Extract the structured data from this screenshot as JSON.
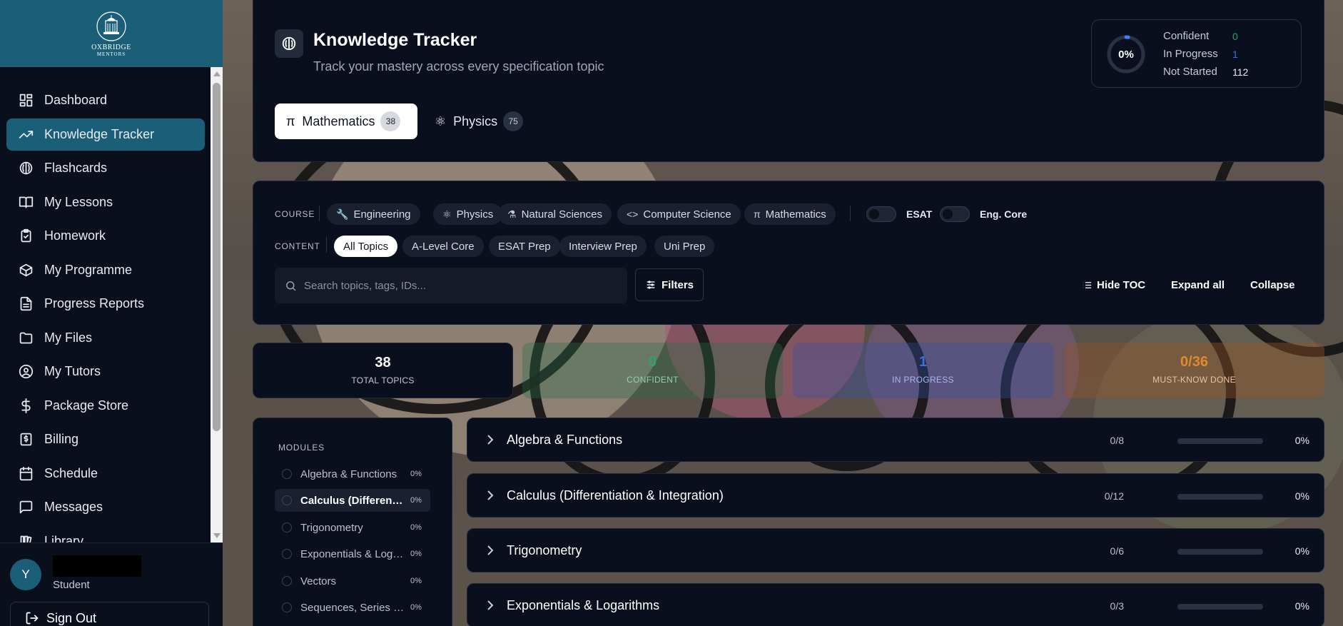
{
  "app": {
    "logo_line1": "OXBRIDGE",
    "logo_line2": "MENTORS"
  },
  "sidebar": {
    "items": [
      {
        "label": "Dashboard",
        "icon": "grid-icon"
      },
      {
        "label": "Knowledge Tracker",
        "icon": "trending-up-icon",
        "active": true
      },
      {
        "label": "Flashcards",
        "icon": "brain-icon"
      },
      {
        "label": "My Lessons",
        "icon": "book-open-icon"
      },
      {
        "label": "Homework",
        "icon": "clipboard-check-icon"
      },
      {
        "label": "My Programme",
        "icon": "package-icon"
      },
      {
        "label": "Progress Reports",
        "icon": "file-text-icon"
      },
      {
        "label": "My Files",
        "icon": "folder-icon"
      },
      {
        "label": "My Tutors",
        "icon": "user-circle-icon"
      },
      {
        "label": "Package Store",
        "icon": "dollar-icon"
      },
      {
        "label": "Billing",
        "icon": "receipt-icon"
      },
      {
        "label": "Schedule",
        "icon": "calendar-icon"
      },
      {
        "label": "Messages",
        "icon": "message-square-icon"
      },
      {
        "label": "Library",
        "icon": "library-icon"
      }
    ],
    "user": {
      "initial": "Y",
      "name_first": "Y",
      "role": "Student"
    },
    "sign_out": "Sign Out"
  },
  "header": {
    "title": "Knowledge Tracker",
    "subtitle": "Track your mastery across every specification topic",
    "tabs": [
      {
        "symbol": "π",
        "label": "Mathematics",
        "count": "38",
        "active": true
      },
      {
        "symbol": "⚛",
        "label": "Physics",
        "count": "75",
        "active": false
      }
    ],
    "summary": {
      "percent": "0%",
      "percent_value": 0.02,
      "confident_label": "Confident",
      "confident_value": "0",
      "in_progress_label": "In Progress",
      "in_progress_value": "1",
      "not_started_label": "Not Started",
      "not_started_value": "112"
    }
  },
  "filters": {
    "course_label": "COURSE",
    "courses": [
      {
        "symbol": "🔧",
        "label": "Engineering"
      },
      {
        "symbol": "⚛",
        "label": "Physics"
      },
      {
        "symbol": "⚗",
        "label": "Natural Sciences"
      },
      {
        "symbol": "<>",
        "label": "Computer Science"
      },
      {
        "symbol": "π",
        "label": "Mathematics"
      }
    ],
    "toggles": [
      {
        "label": "ESAT",
        "on": false
      },
      {
        "label": "Eng. Core",
        "on": false
      }
    ],
    "content_label": "CONTENT",
    "contents": [
      {
        "label": "All Topics",
        "active": true
      },
      {
        "label": "A-Level Core",
        "active": false
      },
      {
        "label": "ESAT Prep",
        "active": false
      },
      {
        "label": "Interview Prep",
        "active": false
      },
      {
        "label": "Uni Prep",
        "active": false
      }
    ],
    "search_placeholder": "Search topics, tags, IDs...",
    "search_value": "",
    "filters_button": "Filters",
    "hide_toc": "Hide TOC",
    "expand_all": "Expand all",
    "collapse": "Collapse"
  },
  "stats": [
    {
      "value": "38",
      "label": "TOTAL TOPICS",
      "color": "#ffffff"
    },
    {
      "value": "0",
      "label": "CONFIDENT",
      "color": "#2fa26b"
    },
    {
      "value": "1",
      "label": "IN PROGRESS",
      "color": "#3b6fe0"
    },
    {
      "value": "0/36",
      "label": "MUST-KNOW DONE",
      "color": "#e08a2a"
    }
  ],
  "modules": {
    "title": "MODULES",
    "items": [
      {
        "name": "Algebra & Functions",
        "pct": "0%",
        "active": false
      },
      {
        "name": "Calculus (Differentiation & Integration)",
        "pct": "0%",
        "active": true
      },
      {
        "name": "Trigonometry",
        "pct": "0%",
        "active": false
      },
      {
        "name": "Exponentials & Logarithms",
        "pct": "0%",
        "active": false
      },
      {
        "name": "Vectors",
        "pct": "0%",
        "active": false
      },
      {
        "name": "Sequences, Series & Proof",
        "pct": "0%",
        "active": false
      }
    ]
  },
  "topics": [
    {
      "name": "Algebra & Functions",
      "count": "0/8",
      "pct": "0%",
      "progress": 0
    },
    {
      "name": "Calculus (Differentiation & Integration)",
      "count": "0/12",
      "pct": "0%",
      "progress": 0
    },
    {
      "name": "Trigonometry",
      "count": "0/6",
      "pct": "0%",
      "progress": 0
    },
    {
      "name": "Exponentials & Logarithms",
      "count": "0/3",
      "pct": "0%",
      "progress": 0
    }
  ],
  "colors": {
    "accent": "#1b5e78",
    "background": "#0a0f1d"
  }
}
